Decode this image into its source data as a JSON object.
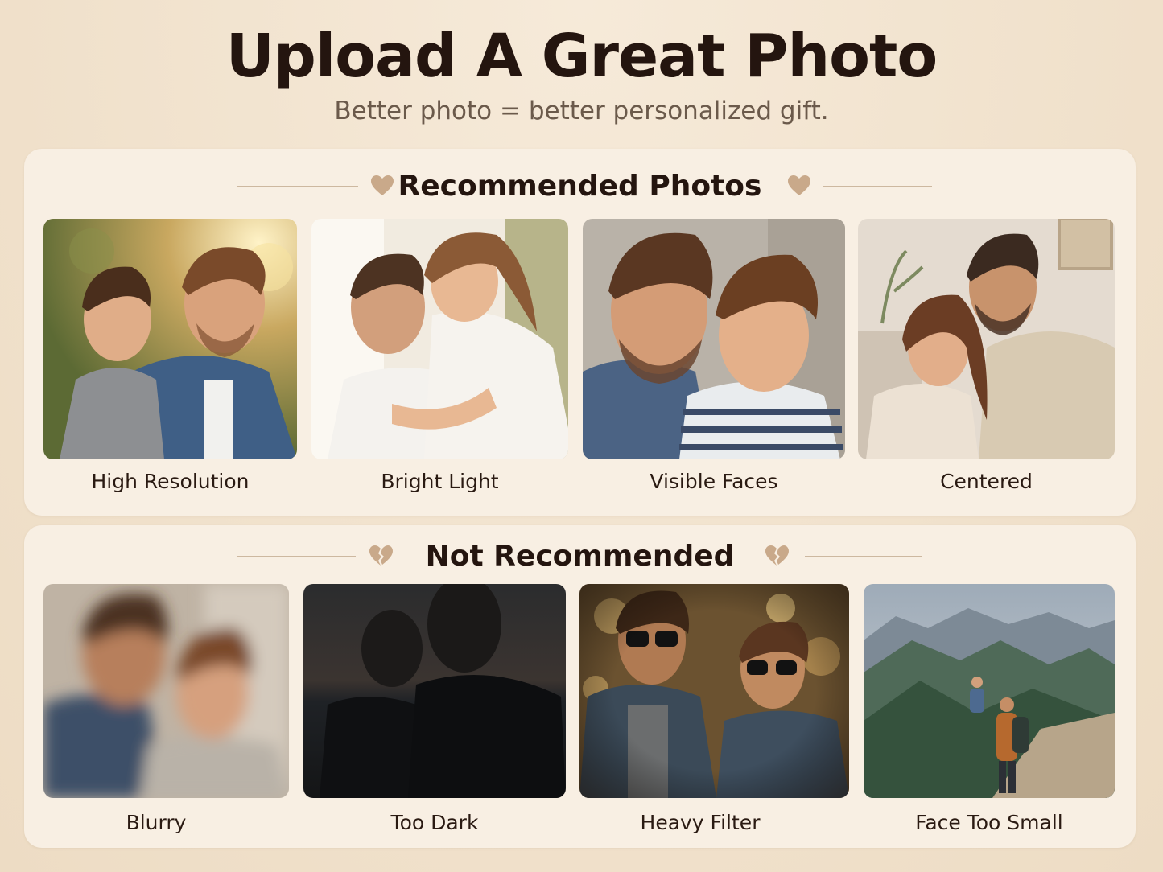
{
  "header": {
    "title": "Upload A Great Photo",
    "subtitle": "Better photo = better personalized gift."
  },
  "recommended": {
    "heading": "Recommended Photos",
    "items": [
      {
        "label": "High Resolution"
      },
      {
        "label": "Bright Light"
      },
      {
        "label": "Visible Faces"
      },
      {
        "label": "Centered"
      }
    ]
  },
  "not_recommended": {
    "heading": "Not Recommended",
    "items": [
      {
        "label": "Blurry"
      },
      {
        "label": "Too Dark"
      },
      {
        "label": "Heavy Filter"
      },
      {
        "label": "Face Too Small"
      }
    ]
  },
  "colors": {
    "background": "#f1e2cd",
    "panel": "#f8efe3",
    "heart": "#c9a98a",
    "title": "#24150f"
  }
}
